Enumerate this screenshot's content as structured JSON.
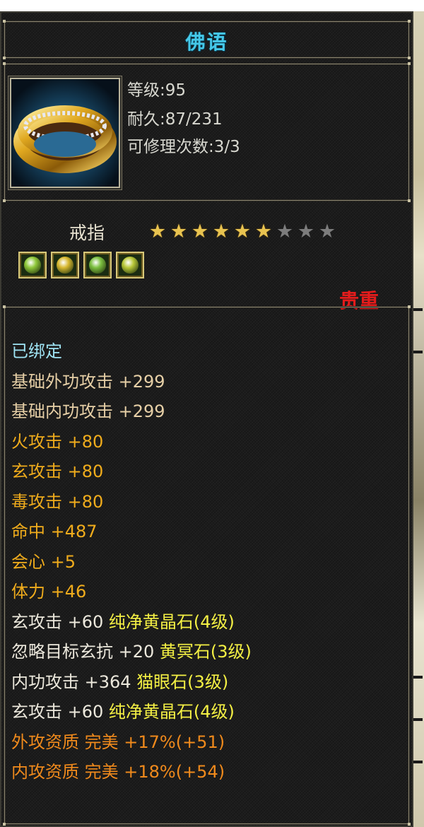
{
  "item": {
    "name": "佛语",
    "level": "等级:95",
    "durability": "耐久:87/231",
    "repairs": "可修理次数:3/3",
    "type": "戒指",
    "precious_label": "贵重",
    "icon": "gold-ring-icon",
    "stars_filled": 6,
    "stars_total": 9
  },
  "gems": [
    {
      "icon": "green-gem-icon",
      "color": "#8fc83a"
    },
    {
      "icon": "yellow-gem-icon",
      "color": "#d8b830"
    },
    {
      "icon": "green-gem-icon",
      "color": "#7cc040"
    },
    {
      "icon": "yellow-green-gem-icon",
      "color": "#b8c838"
    }
  ],
  "attributes": [
    {
      "parts": [
        {
          "text": "已绑定",
          "color": "cyan"
        }
      ]
    },
    {
      "parts": [
        {
          "text": "基础外功攻击  +299",
          "color": "beige"
        }
      ]
    },
    {
      "parts": [
        {
          "text": "基础内功攻击  +299",
          "color": "beige"
        }
      ]
    },
    {
      "parts": [
        {
          "text": "火攻击  +80",
          "color": "orange"
        }
      ]
    },
    {
      "parts": [
        {
          "text": "玄攻击  +80",
          "color": "orange"
        }
      ]
    },
    {
      "parts": [
        {
          "text": "毒攻击  +80",
          "color": "orange"
        }
      ]
    },
    {
      "parts": [
        {
          "text": "命中  +487",
          "color": "orange"
        }
      ]
    },
    {
      "parts": [
        {
          "text": "会心  +5",
          "color": "orange"
        }
      ]
    },
    {
      "parts": [
        {
          "text": "体力  +46",
          "color": "orange"
        }
      ]
    },
    {
      "parts": [
        {
          "text": "玄攻击  +60 ",
          "color": "white"
        },
        {
          "text": "纯净黄晶石(4级)",
          "color": "yellow"
        }
      ]
    },
    {
      "parts": [
        {
          "text": "忽略目标玄抗  +20 ",
          "color": "white"
        },
        {
          "text": "黄冥石(3级)",
          "color": "yellow"
        }
      ]
    },
    {
      "parts": [
        {
          "text": "内功攻击  +364 ",
          "color": "white"
        },
        {
          "text": "猫眼石(3级)",
          "color": "yellow"
        }
      ]
    },
    {
      "parts": [
        {
          "text": "玄攻击  +60 ",
          "color": "white"
        },
        {
          "text": "纯净黄晶石(4级)",
          "color": "yellow"
        }
      ]
    },
    {
      "parts": [
        {
          "text": "外攻资质  完美 +17%(+51)",
          "color": "orange2"
        }
      ]
    },
    {
      "parts": [
        {
          "text": "内攻资质  完美 +18%(+54)",
          "color": "orange2"
        }
      ]
    }
  ],
  "colors": {
    "cyan": "#9fe4f4",
    "beige": "#e6cfa6",
    "orange": "#f0ac1c",
    "white": "#ece8dc",
    "yellow": "#f4f044",
    "orange2": "#f08a1c",
    "title": "#45c8e8",
    "precious": "#e41c1c"
  }
}
